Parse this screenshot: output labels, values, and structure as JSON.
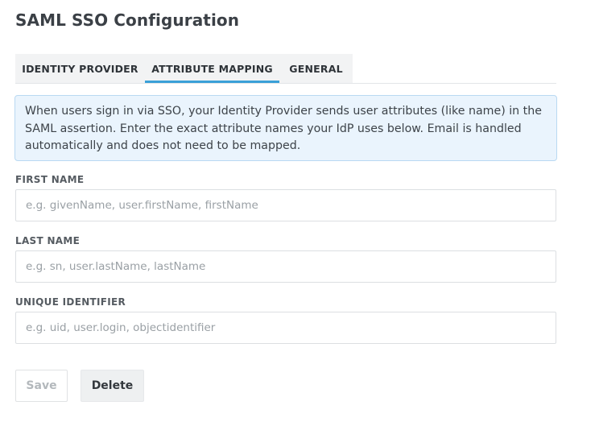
{
  "page": {
    "title": "SAML SSO Configuration"
  },
  "tabs": [
    {
      "label": "IDENTITY PROVIDER",
      "active": false
    },
    {
      "label": "ATTRIBUTE MAPPING",
      "active": true
    },
    {
      "label": "GENERAL",
      "active": false
    }
  ],
  "info": {
    "text": "When users sign in via SSO, your Identity Provider sends user attributes (like name) in the SAML assertion. Enter the exact attribute names your IdP uses below. Email is handled automatically and does not need to be mapped."
  },
  "fields": {
    "first_name": {
      "label": "FIRST NAME",
      "value": "",
      "placeholder": "e.g. givenName, user.firstName, firstName"
    },
    "last_name": {
      "label": "LAST NAME",
      "value": "",
      "placeholder": "e.g. sn, user.lastName, lastName"
    },
    "unique_identifier": {
      "label": "UNIQUE IDENTIFIER",
      "value": "",
      "placeholder": "e.g. uid, user.login, objectidentifier"
    }
  },
  "actions": {
    "save_label": "Save",
    "delete_label": "Delete"
  },
  "colors": {
    "accent": "#3aa0d8",
    "info_background": "#eaf4fd",
    "info_border": "#b9d9f2"
  }
}
